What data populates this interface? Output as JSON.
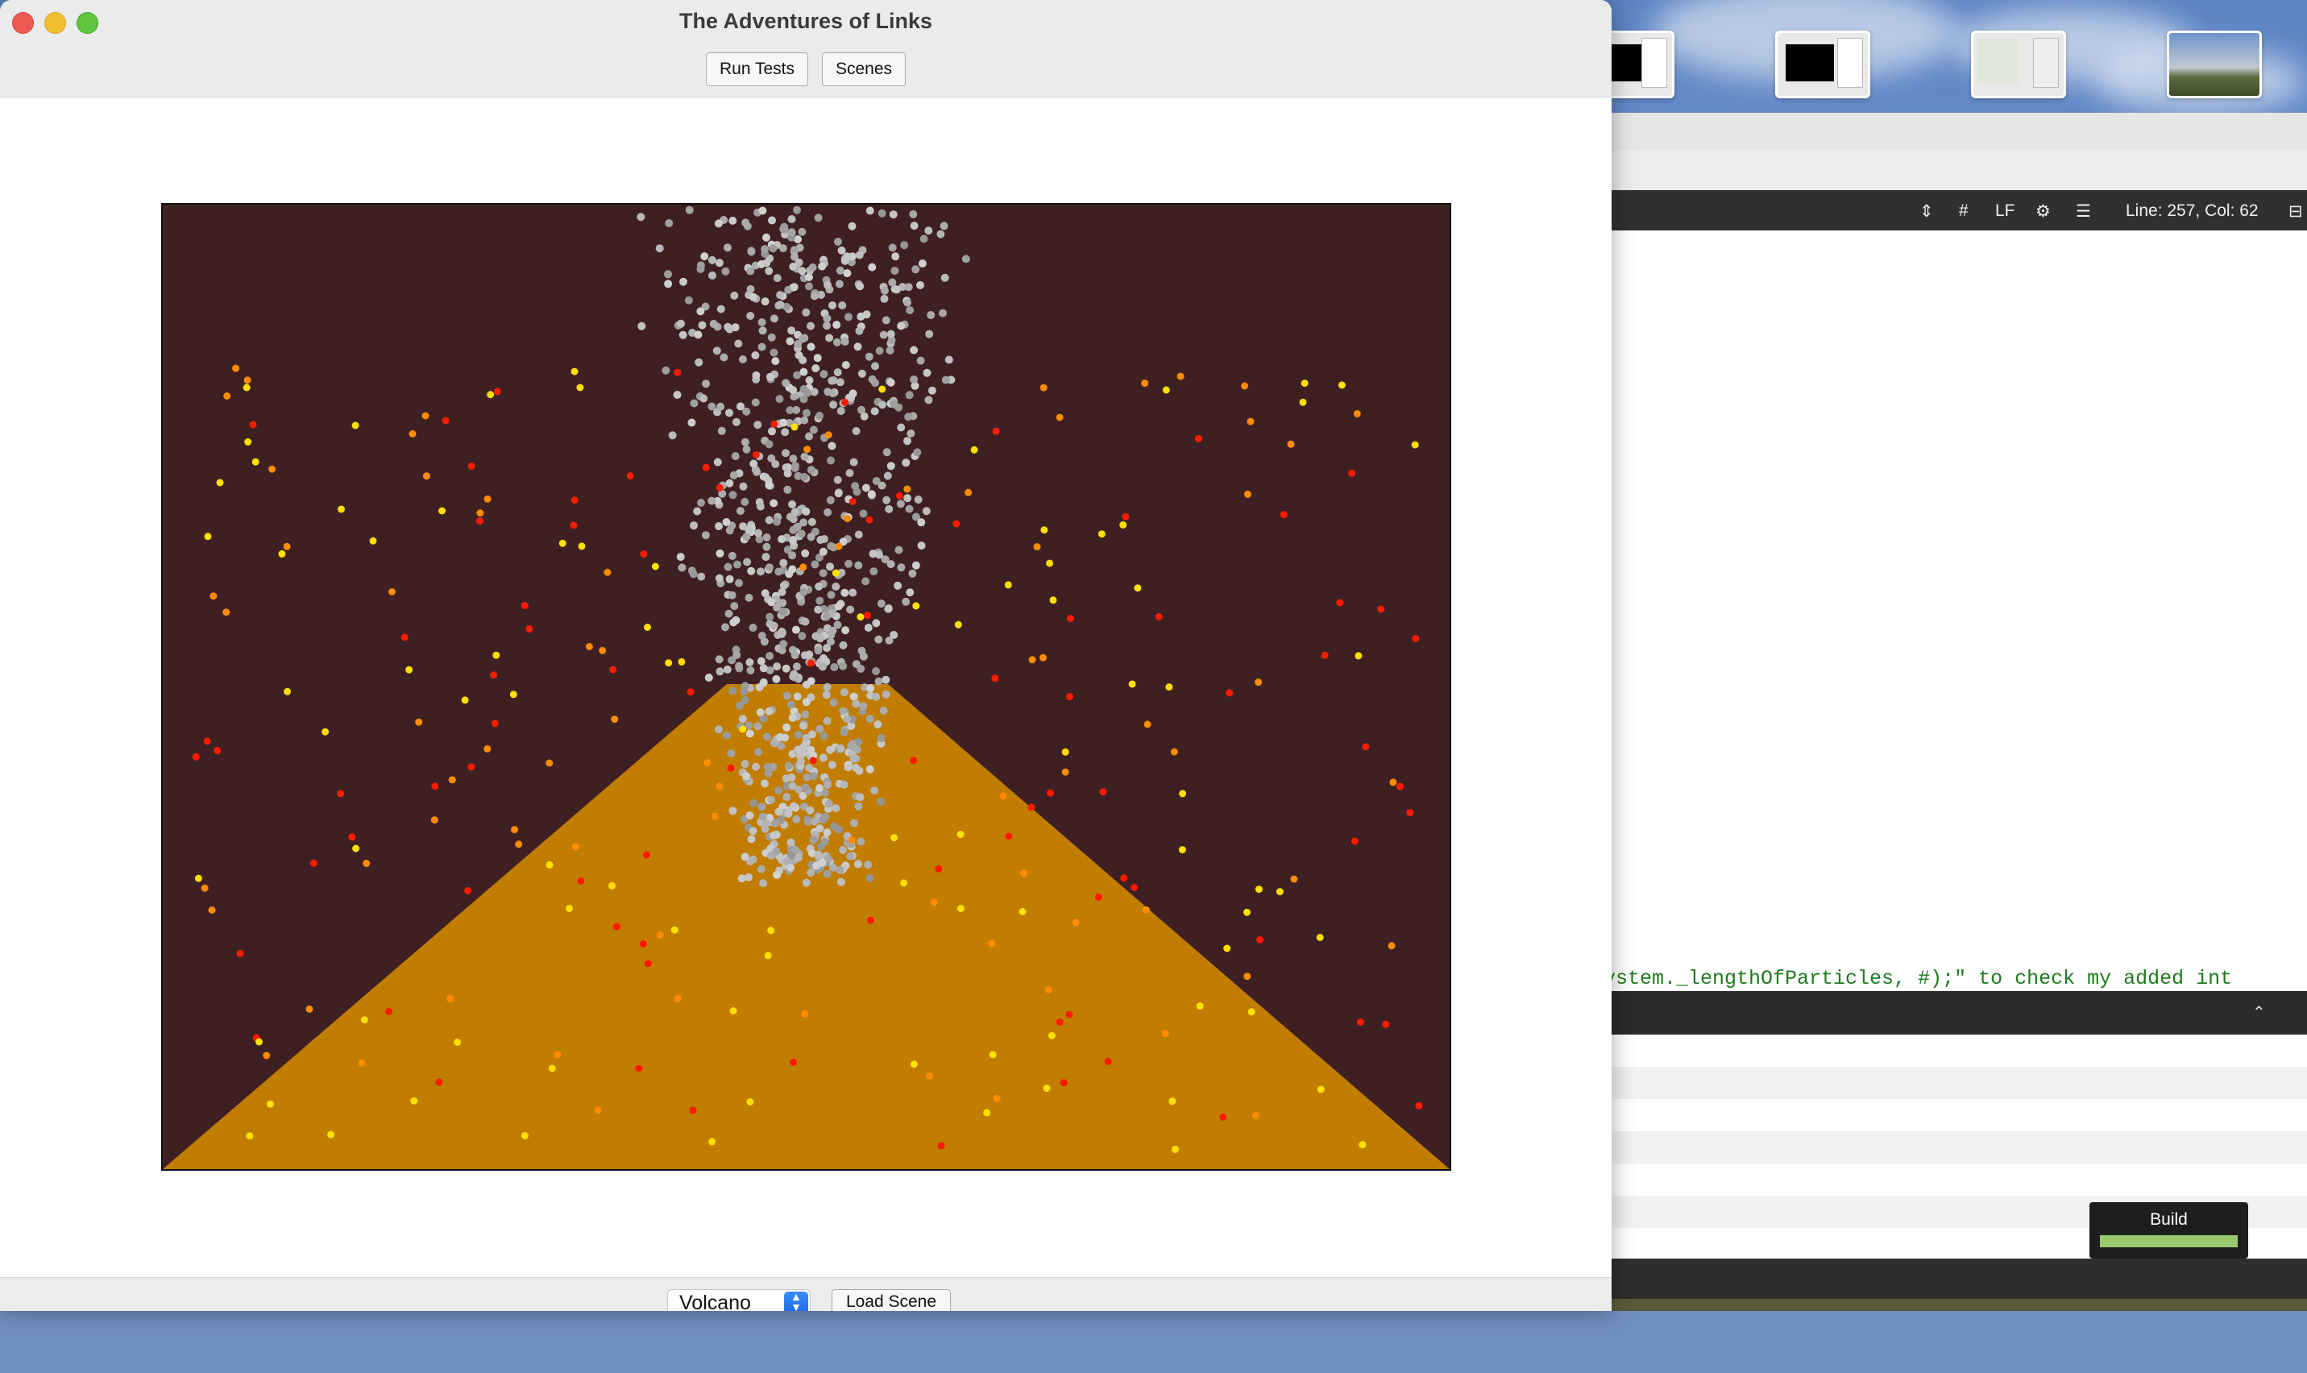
{
  "main_window": {
    "title": "The Adventures of Links",
    "toolbar": {
      "run_tests_label": "Run Tests",
      "scenes_label": "Scenes"
    },
    "scene": {
      "sky_color": "#3e2023",
      "volcano_color": "#c17d00",
      "particle_colors": [
        "#ffe000",
        "#ff8c00",
        "#ff1a00",
        "#c8c8c8"
      ]
    },
    "bottom_bar": {
      "scene_select_value": "Volcano",
      "load_scene_label": "Load Scene"
    }
  },
  "editor": {
    "status": {
      "hash": "#",
      "line_ending": "LF",
      "position": "Line: 257, Col: 62"
    },
    "code_snippet": "ystem._lengthOfParticles, #);\" to check my added int",
    "build_label": "Build"
  }
}
